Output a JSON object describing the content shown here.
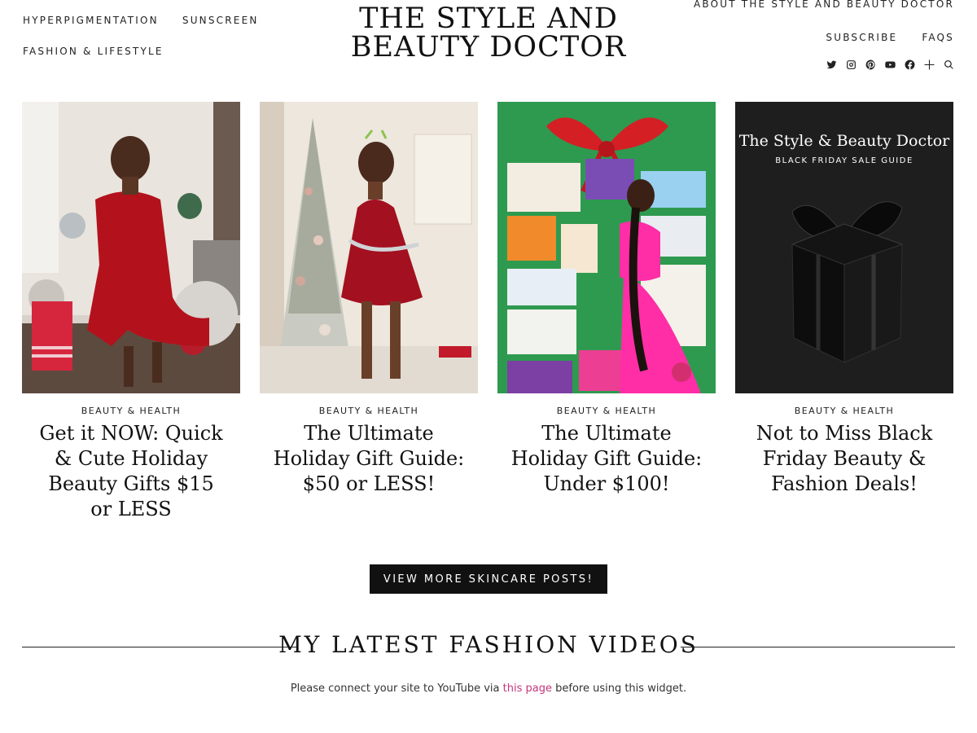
{
  "nav": {
    "left": [
      "HYPERPIGMENTATION",
      "SUNSCREEN",
      "FASHION & LIFESTYLE"
    ],
    "right_top": "ABOUT THE STYLE AND BEAUTY DOCTOR",
    "right_row": [
      "SUBSCRIBE",
      "FAQS"
    ]
  },
  "logo": {
    "line1": "THE STYLE AND",
    "line2": "BEAUTY DOCTOR"
  },
  "social_icons": [
    "twitter-icon",
    "instagram-icon",
    "pinterest-icon",
    "youtube-icon",
    "facebook-icon",
    "bloglovin-icon",
    "search-icon"
  ],
  "posts": [
    {
      "category": "BEAUTY & HEALTH",
      "title": "Get it NOW: Quick & Cute Holiday Beauty Gifts $15 or LESS",
      "image": "woman in red dress holding ornaments"
    },
    {
      "category": "BEAUTY & HEALTH",
      "title": "The Ultimate Holiday Gift Guide: $50 or LESS!",
      "image": "woman in red dress beside christmas tree"
    },
    {
      "category": "BEAUTY & HEALTH",
      "title": "The Ultimate Holiday Gift Guide: Under $100!",
      "image": "woman in pink with beauty products gift collage"
    },
    {
      "category": "BEAUTY & HEALTH",
      "title": "Not to Miss Black Friday Beauty & Fashion Deals!",
      "image": "black gift box",
      "overlay_brand": "The Style & Beauty Doctor",
      "overlay_sub": "BLACK FRIDAY SALE GUIDE"
    }
  ],
  "more_button": "VIEW MORE SKINCARE POSTS!",
  "section_title": "MY LATEST FASHION VIDEOS",
  "youtube_message": {
    "before": "Please connect your site to YouTube via ",
    "link": "this page",
    "after": " before using this widget."
  },
  "colors": {
    "link_pink": "#c7357d",
    "button_bg": "#111111",
    "green_bg": "#2e9a4f",
    "red_dress": "#b3121c",
    "dark_card": "#1e1e1e"
  }
}
